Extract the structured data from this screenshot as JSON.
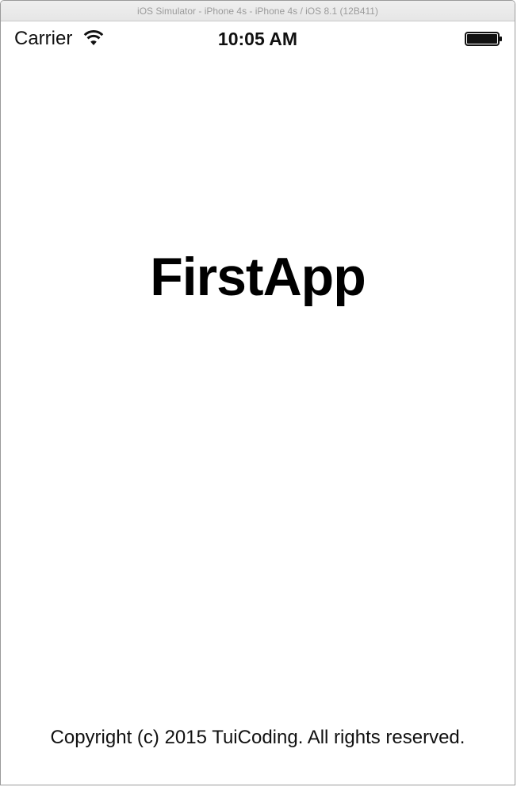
{
  "window": {
    "title": "iOS Simulator - iPhone 4s - iPhone 4s / iOS 8.1 (12B411)"
  },
  "status_bar": {
    "carrier": "Carrier",
    "time": "10:05 AM",
    "wifi_icon": "wifi-icon",
    "battery_icon": "battery-icon",
    "battery_level": 1.0
  },
  "app": {
    "title": "FirstApp",
    "copyright": "Copyright (c) 2015 TuiCoding. All rights reserved."
  },
  "colors": {
    "background": "#ffffff",
    "text": "#000000",
    "titlebar_text": "#9b9b9b"
  }
}
